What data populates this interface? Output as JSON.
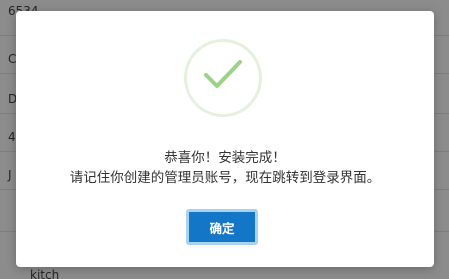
{
  "background": {
    "fragments": [
      "6534",
      "C",
      "D",
      "4",
      "J",
      "kitch"
    ]
  },
  "dialog": {
    "icon": "check-circle-icon",
    "icon_color": "#9bd386",
    "ring_color": "#e4f1df",
    "message_line1": "恭喜你！安装完成！",
    "message_line2": "请记住你创建的管理员账号，现在跳转到登录界面。",
    "confirm_label": "确定",
    "confirm_color": "#1476c6"
  }
}
